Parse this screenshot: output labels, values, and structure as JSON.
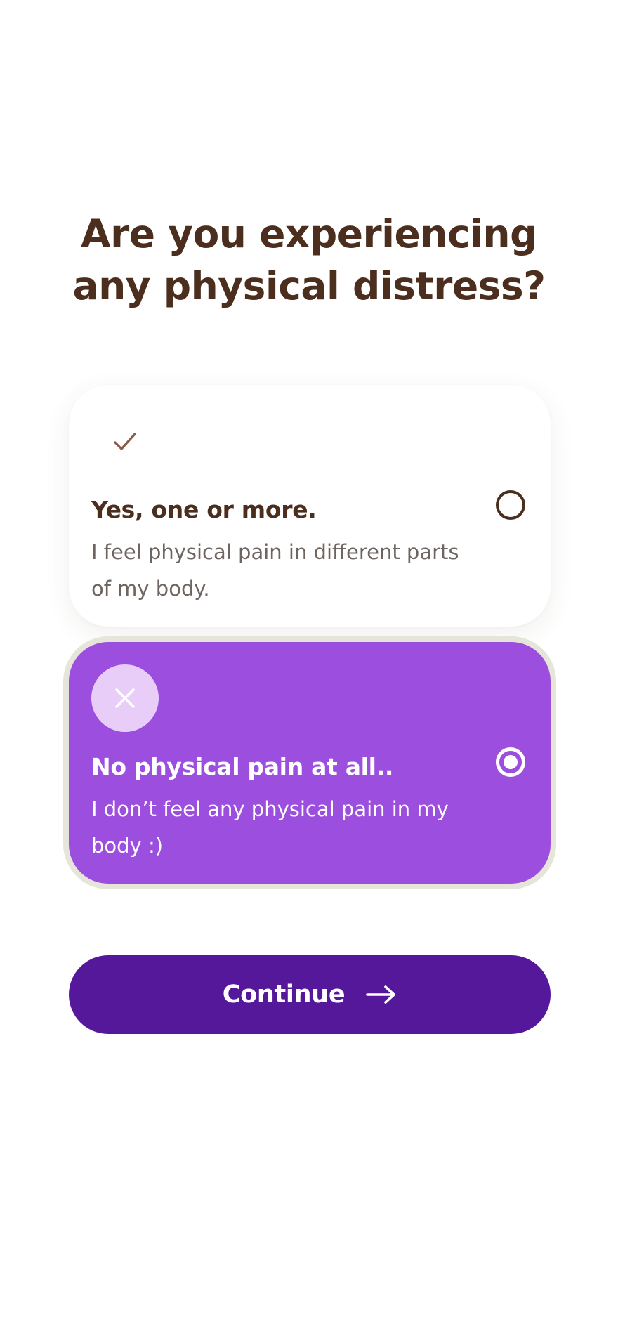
{
  "question": {
    "title": "Are you experiencing any physical distress?"
  },
  "options": [
    {
      "title": "Yes, one or more.",
      "description": "I feel physical pain in different parts of my body.",
      "icon": "check-icon",
      "selected": false
    },
    {
      "title": "No physical pain at all..",
      "description": "I don’t feel any physical pain in my body :)",
      "icon": "close-icon",
      "selected": true
    }
  ],
  "continue_button": {
    "label": "Continue",
    "icon": "arrow-right-icon"
  },
  "colors": {
    "title_text": "#4b2e1e",
    "selected_card": "#9c4fdf",
    "selected_icon_bg": "#e8cdf9",
    "selected_ring": "#e6e5da",
    "button": "#56189a"
  }
}
